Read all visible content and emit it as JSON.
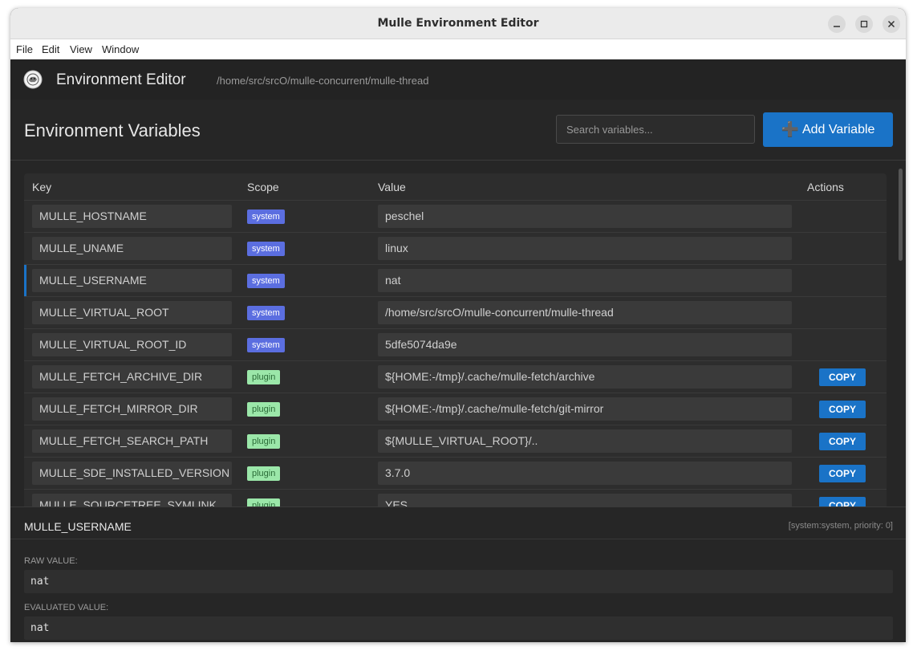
{
  "window": {
    "title": "Mulle Environment Editor"
  },
  "menu": [
    "File",
    "Edit",
    "View",
    "Window"
  ],
  "app": {
    "title": "Environment Editor",
    "path": "/home/src/srcO/mulle-concurrent/mulle-thread"
  },
  "section": {
    "title": "Environment Variables",
    "search_placeholder": "Search variables...",
    "add_label": "Add Variable"
  },
  "table": {
    "headers": {
      "key": "Key",
      "scope": "Scope",
      "value": "Value",
      "actions": "Actions"
    },
    "copy_label": "COPY",
    "rows": [
      {
        "key": "MULLE_HOSTNAME",
        "scope": "system",
        "value": "peschel"
      },
      {
        "key": "MULLE_UNAME",
        "scope": "system",
        "value": "linux"
      },
      {
        "key": "MULLE_USERNAME",
        "scope": "system",
        "value": "nat"
      },
      {
        "key": "MULLE_VIRTUAL_ROOT",
        "scope": "system",
        "value": "/home/src/srcO/mulle-concurrent/mulle-thread"
      },
      {
        "key": "MULLE_VIRTUAL_ROOT_ID",
        "scope": "system",
        "value": "5dfe5074da9e"
      },
      {
        "key": "MULLE_FETCH_ARCHIVE_DIR",
        "scope": "plugin",
        "value": "${HOME:-/tmp}/.cache/mulle-fetch/archive"
      },
      {
        "key": "MULLE_FETCH_MIRROR_DIR",
        "scope": "plugin",
        "value": "${HOME:-/tmp}/.cache/mulle-fetch/git-mirror"
      },
      {
        "key": "MULLE_FETCH_SEARCH_PATH",
        "scope": "plugin",
        "value": "${MULLE_VIRTUAL_ROOT}/.."
      },
      {
        "key": "MULLE_SDE_INSTALLED_VERSION",
        "scope": "plugin",
        "value": "3.7.0"
      },
      {
        "key": "MULLE_SOURCETREE_SYMLINK",
        "scope": "plugin",
        "value": "YES"
      }
    ]
  },
  "details": {
    "key": "MULLE_USERNAME",
    "meta": "[system:system, priority: 0]",
    "raw_label": "RAW VALUE:",
    "raw_value": "nat",
    "eval_label": "EVALUATED VALUE:",
    "eval_value": "nat"
  },
  "colors": {
    "accent": "#1a73c7",
    "system_badge": "#5b6ee0",
    "plugin_badge": "#9be7a9"
  }
}
